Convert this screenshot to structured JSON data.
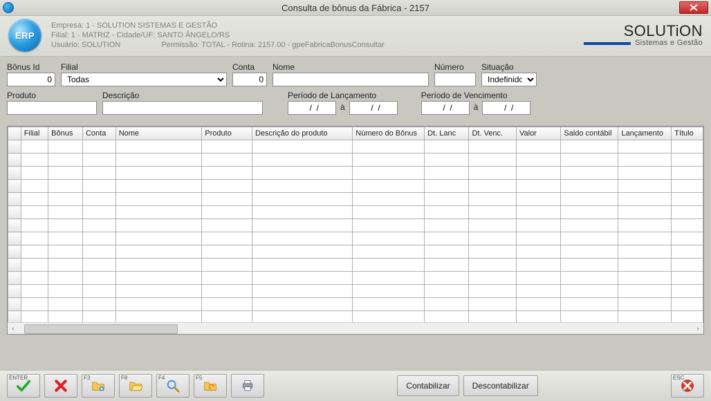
{
  "window": {
    "title": "Consulta de bônus da Fábrica - 2157"
  },
  "header": {
    "empresa": "Empresa: 1 - SOLUTION SISTEMAS E GESTÃO",
    "filial": "Filial: 1 - MATRIZ - Cidade/UF: SANTO ÂNGELO/RS",
    "usuario": "Usuário: SOLUTION",
    "permissao": "Permissão: TOTAL - Rotina: 2157.00 - gpeFabricaBonusConsultar"
  },
  "brand": {
    "main": "SOLUTiON",
    "sub": "Sistemas e Gestão"
  },
  "filters": {
    "row1": {
      "bonus_id": {
        "label": "Bônus Id",
        "value": "0"
      },
      "filial": {
        "label": "Filial",
        "value": "Todas",
        "options": [
          "Todas"
        ]
      },
      "conta": {
        "label": "Conta",
        "value": "0"
      },
      "nome": {
        "label": "Nome",
        "value": ""
      },
      "numero": {
        "label": "Número",
        "value": ""
      },
      "situacao": {
        "label": "Situação",
        "value": "Indefinido",
        "options": [
          "Indefinido"
        ]
      }
    },
    "row2": {
      "produto": {
        "label": "Produto",
        "value": ""
      },
      "descricao": {
        "label": "Descrição",
        "value": ""
      },
      "periodo_lanc": {
        "label": "Período de Lançamento",
        "from": "  /  /",
        "to": "  /  /",
        "sep": "à"
      },
      "periodo_venc": {
        "label": "Período de Vencimento",
        "from": "  /  /",
        "to": "  /  /",
        "sep": "à"
      }
    }
  },
  "grid": {
    "columns": [
      "",
      "Filial",
      "Bônus",
      "Conta",
      "Nome",
      "Produto",
      "Descrição do produto",
      "Número do Bônus",
      "Dt. Lanc",
      "Dt. Venc.",
      "Valor",
      "Saldo contábil",
      "Lançamento",
      "Título"
    ],
    "rows": []
  },
  "toolbar": {
    "enter_key": "ENTER",
    "f3_key": "F3",
    "f8_key": "F8",
    "f4_key": "F4",
    "f5_key": "F5",
    "esc_key": "ESC",
    "contab": "Contabilizar",
    "descontab": "Descontabilizar"
  }
}
